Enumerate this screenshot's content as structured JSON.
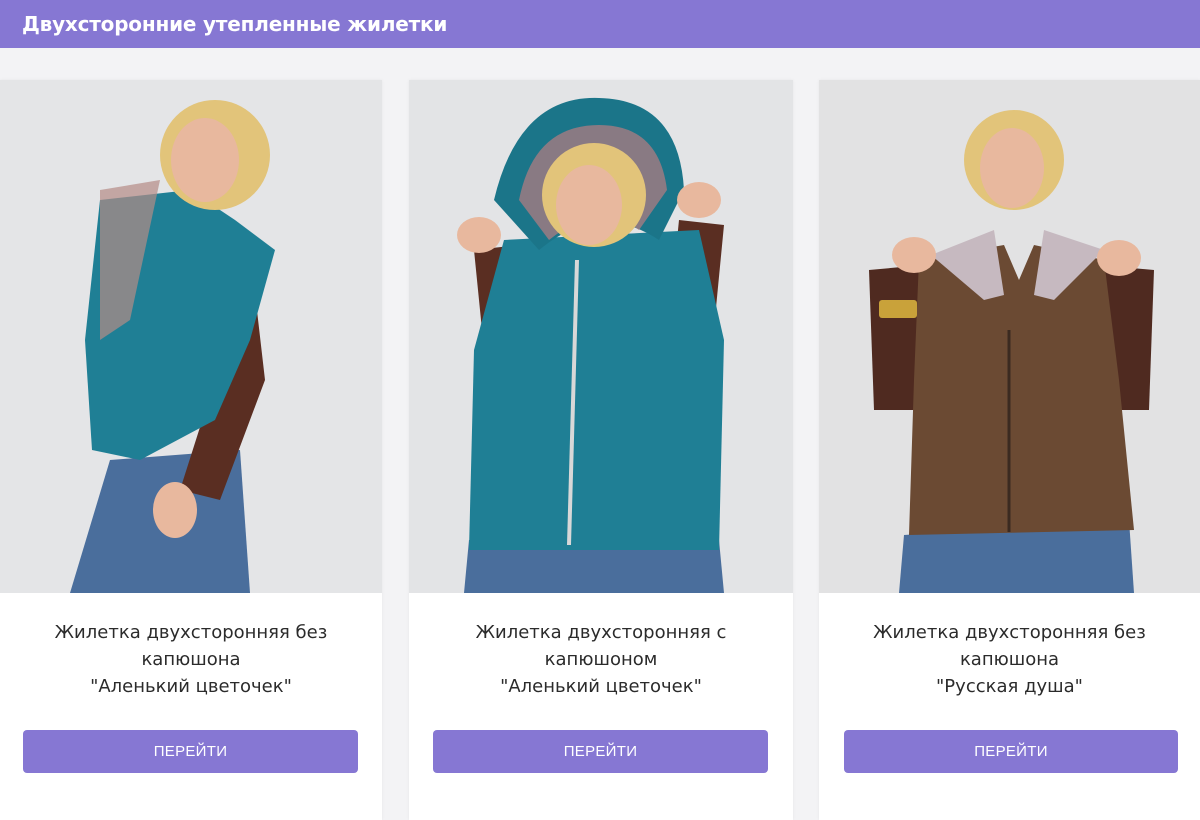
{
  "header": {
    "title": "Двухсторонние утепленные жилетки"
  },
  "products": [
    {
      "name_lines": [
        "Жилетка двухсторонняя без",
        "капюшона",
        "\"Аленький цветочек\""
      ],
      "button_label": "ПЕРЕЙТИ",
      "vest_color": "#1f7f95"
    },
    {
      "name_lines": [
        "Жилетка двухсторонняя с",
        "капюшоном",
        "\"Аленький цветочек\""
      ],
      "button_label": "ПЕРЕЙТИ",
      "vest_color": "#1f7f95"
    },
    {
      "name_lines": [
        "Жилетка двухсторонняя без",
        "капюшона",
        "\"Русская душа\""
      ],
      "button_label": "ПЕРЕЙТИ",
      "vest_color": "#6b4a33"
    }
  ],
  "colors": {
    "accent": "#8677d3",
    "card_bg": "#ffffff",
    "page_bg": "#f3f3f5"
  }
}
